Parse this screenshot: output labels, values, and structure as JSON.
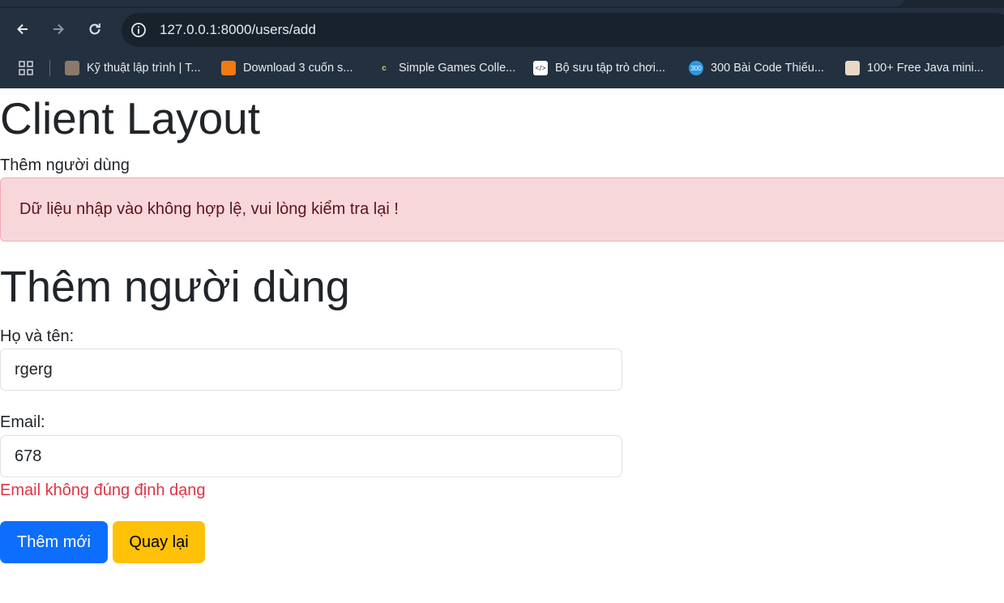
{
  "browser": {
    "url": "127.0.0.1:8000/users/add",
    "bookmarks": [
      {
        "label": "Kỹ thuật lập trình | T...",
        "icon": "photo-favicon-icon"
      },
      {
        "label": "Download 3 cuốn s...",
        "icon": "orange-favicon-icon"
      },
      {
        "label": "Simple Games Colle...",
        "icon": "c-favicon-icon"
      },
      {
        "label": "Bộ sưu tập trò chơi...",
        "icon": "code-favicon-icon"
      },
      {
        "label": "300 Bài Code Thiếu...",
        "icon": "300-favicon-icon",
        "badge": "300"
      },
      {
        "label": "100+ Free Java mini...",
        "icon": "avatar-favicon-icon"
      }
    ]
  },
  "page": {
    "layout_title": "Client Layout",
    "subtitle": "Thêm người dùng",
    "alert": "Dữ liệu nhập vào không hợp lệ, vui lòng kiểm tra lại !",
    "form_title": "Thêm người dùng",
    "name_label": "Họ và tên:",
    "name_value": "rgerg",
    "email_label": "Email:",
    "email_value": "678",
    "email_error": "Email không đúng định dạng",
    "submit_label": "Thêm mới",
    "back_label": "Quay lại"
  },
  "colors": {
    "primary": "#0d6efd",
    "warning": "#ffc107",
    "danger": "#dc3545",
    "alert_bg": "#f8d7da"
  }
}
